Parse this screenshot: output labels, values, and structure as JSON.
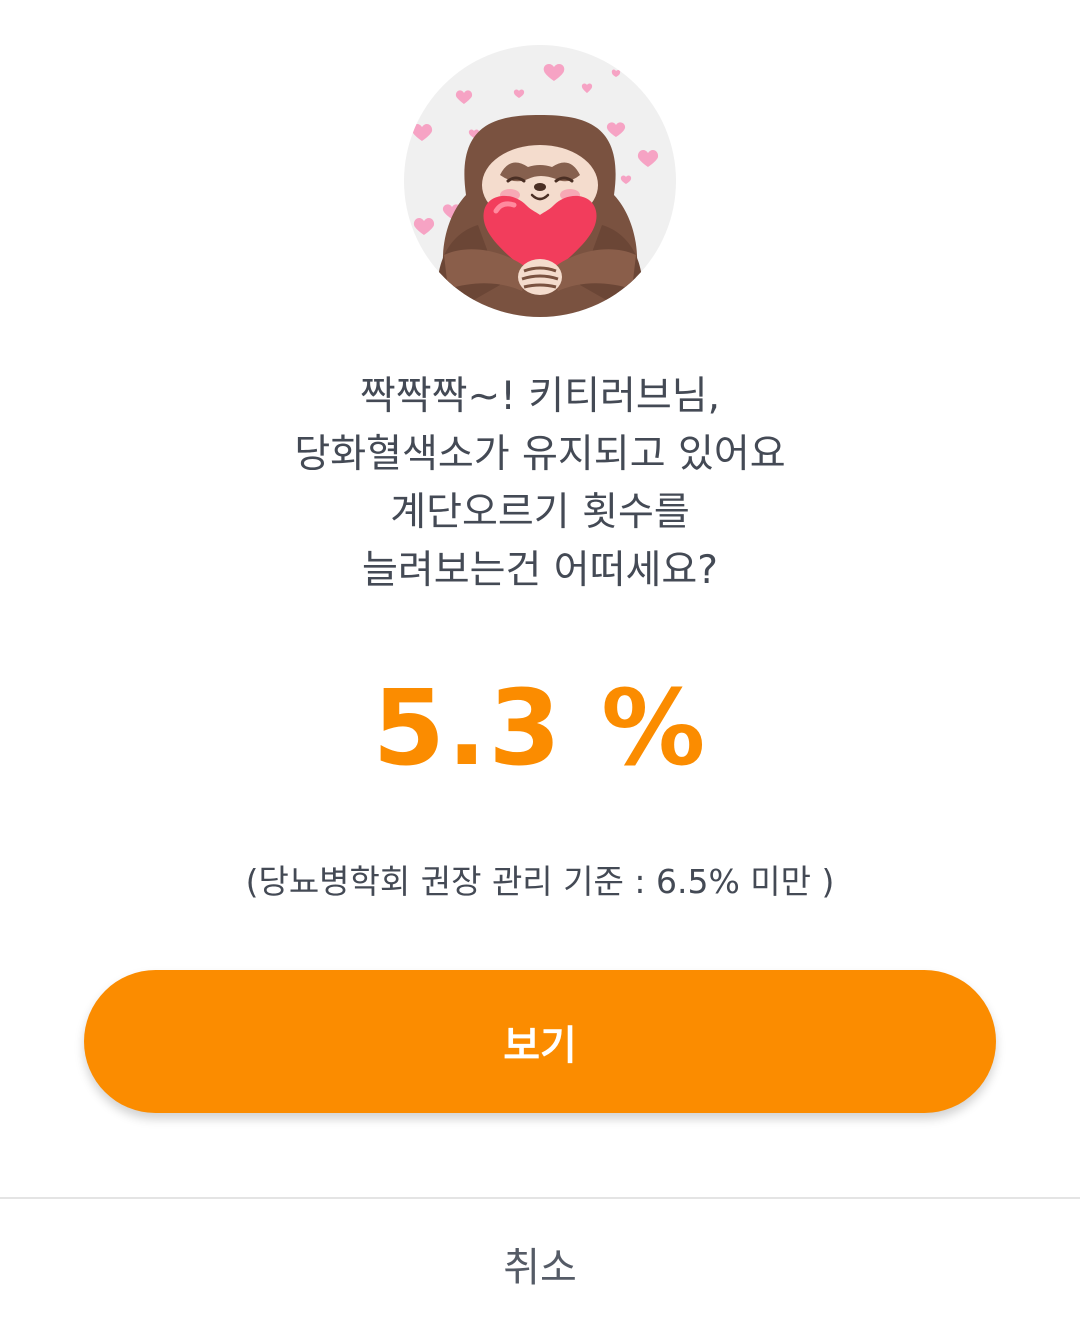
{
  "dialog": {
    "illustration": "sloth-holding-heart",
    "message_lines": [
      "짝짝짝~! 키티러브님,",
      "당화혈색소가 유지되고 있어요",
      "계단오르기 횟수를",
      "늘려보는건 어떠세요?"
    ],
    "value_text": "5.3 %",
    "standard_text": "(당뇨병학회 권장 관리 기준 : 6.5% 미만 )",
    "primary_button_label": "보기",
    "cancel_button_label": "취소"
  },
  "colors": {
    "accent": "#fb8c00",
    "text": "#444a55",
    "avatar_background": "#f0f0f0"
  }
}
